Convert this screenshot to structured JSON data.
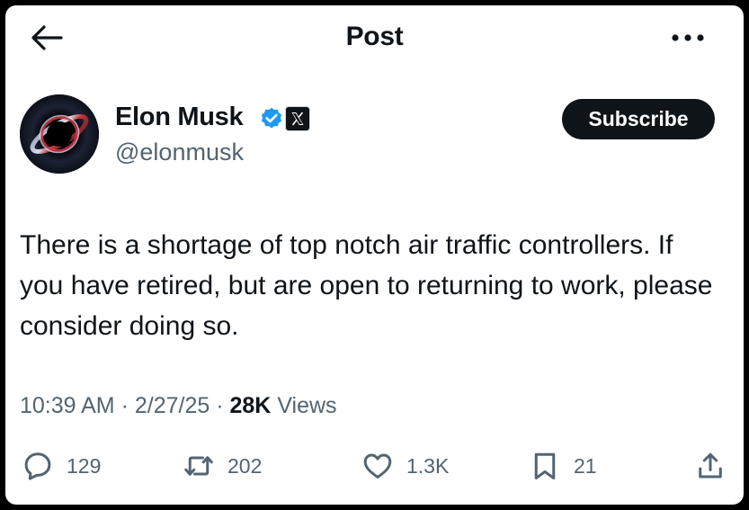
{
  "header": {
    "title": "Post",
    "back_icon": "arrow-left-icon",
    "more_icon": "more-horizontal-icon"
  },
  "author": {
    "display_name": "Elon Musk",
    "handle": "@elonmusk",
    "verified_icon": "verified-badge-icon",
    "affiliation_icon": "x-logo-icon",
    "verified_color": "#1d9bf0"
  },
  "subscribe": {
    "label": "Subscribe"
  },
  "post": {
    "text": "There is a shortage of top notch air traffic controllers. If you have retired, but are open to returning to work, please consider doing so."
  },
  "meta": {
    "time": "10:39 AM",
    "sep1": " · ",
    "date": "2/27/25",
    "sep2": " · ",
    "views_count": "28K",
    "views_label": " Views"
  },
  "actions": {
    "replies": "129",
    "reposts": "202",
    "likes": "1.3K",
    "bookmarks": "21"
  },
  "colors": {
    "text_primary": "#0f1419",
    "text_secondary": "#536471",
    "accent": "#1d9bf0"
  }
}
